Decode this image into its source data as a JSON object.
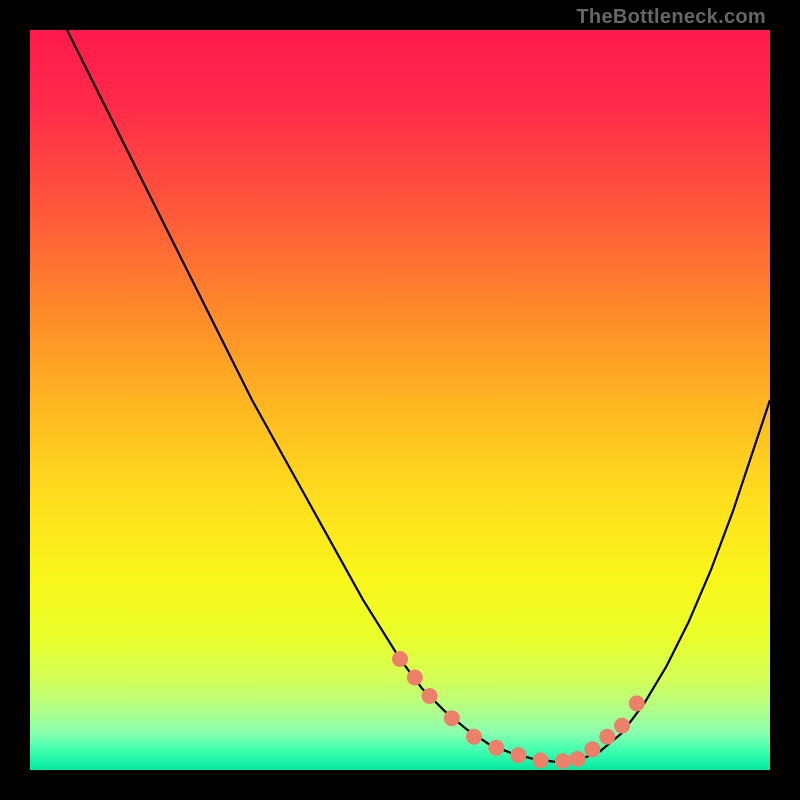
{
  "watermark": "TheBottleneck.com",
  "chart_data": {
    "type": "line",
    "title": "",
    "xlabel": "",
    "ylabel": "",
    "xlim": [
      0,
      100
    ],
    "ylim": [
      0,
      100
    ],
    "series": [
      {
        "name": "curve",
        "x": [
          5,
          10,
          15,
          20,
          25,
          30,
          35,
          40,
          45,
          50,
          53,
          56,
          59,
          62,
          65,
          68,
          71,
          74,
          77,
          80,
          83,
          86,
          89,
          92,
          95,
          100
        ],
        "y": [
          100,
          90,
          80,
          70,
          60,
          50,
          41,
          32,
          23,
          15,
          11,
          8,
          5.5,
          3.5,
          2.3,
          1.5,
          1.1,
          1.3,
          2.5,
          5,
          9,
          14,
          20,
          27,
          35,
          50
        ]
      }
    ],
    "highlight_points": {
      "name": "markers",
      "x": [
        50,
        52,
        54,
        57,
        60,
        63,
        66,
        69,
        72,
        74,
        76,
        78,
        80,
        82
      ],
      "y": [
        15,
        12.5,
        10,
        7,
        4.5,
        3,
        2,
        1.3,
        1.2,
        1.5,
        2.8,
        4.5,
        6,
        9
      ]
    },
    "colors": {
      "curve_stroke": "#000000",
      "marker_fill": "#ed806b",
      "gradient_top": "#ff1a4d",
      "gradient_mid": "#ffdb1e",
      "gradient_bottom": "#00e9a0"
    }
  }
}
